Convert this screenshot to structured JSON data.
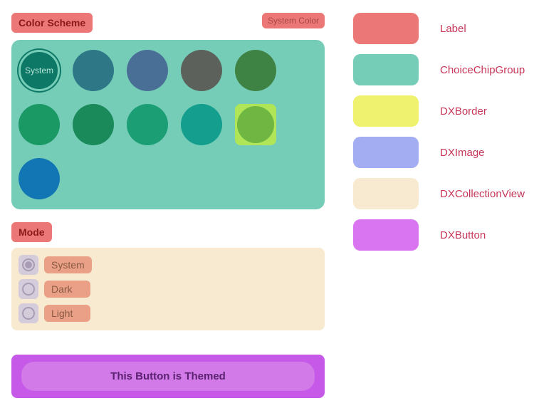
{
  "header": {
    "title": "Color Scheme",
    "systemColorLabel": "System Color"
  },
  "chipGroup": {
    "systemLabel": "System",
    "swatches": [
      {
        "color": "#2d7787"
      },
      {
        "color": "#4a6f97"
      },
      {
        "color": "#5c615c"
      },
      {
        "color": "#3f8344"
      },
      {
        "color": "#1a9964"
      },
      {
        "color": "#1b8a5a"
      },
      {
        "color": "#1c9e74"
      },
      {
        "color": "#139e8e"
      },
      {
        "highlighted": true
      },
      {
        "color": "#1276b4"
      }
    ]
  },
  "mode": {
    "title": "Mode",
    "options": [
      "System",
      "Dark",
      "Light"
    ],
    "selected": 0
  },
  "button": {
    "label": "This Button is Themed"
  },
  "legend": [
    {
      "color": "#ec7777",
      "name": "Label"
    },
    {
      "color": "#76cdb7",
      "name": "ChoiceChipGroup"
    },
    {
      "color": "#eef26f",
      "name": "DXBorder"
    },
    {
      "color": "#a2adf2",
      "name": "DXImage"
    },
    {
      "color": "#f8ead0",
      "name": "DXCollectionView"
    },
    {
      "color": "#d975f0",
      "name": "DXButton"
    }
  ]
}
